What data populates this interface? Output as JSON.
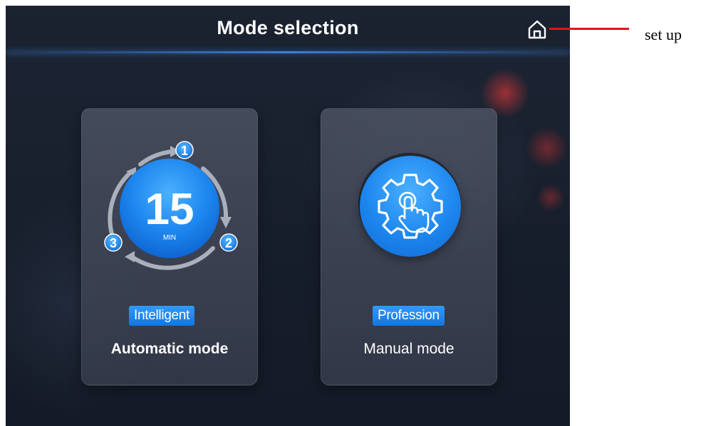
{
  "header": {
    "title": "Mode selection",
    "home_icon": "home-icon"
  },
  "cards": {
    "auto": {
      "badge": "Intelligent",
      "label": "Automatic mode",
      "timer_value": "15",
      "timer_unit": "MIN",
      "steps": [
        "1",
        "2",
        "3"
      ]
    },
    "manual": {
      "badge": "Profession",
      "label": "Manual mode",
      "icon": "gear-touch-icon"
    }
  },
  "annotation": {
    "text": "set up"
  },
  "colors": {
    "accent": "#1d86ee",
    "background": "#171e2b",
    "annotation_line": "#e0141b"
  }
}
